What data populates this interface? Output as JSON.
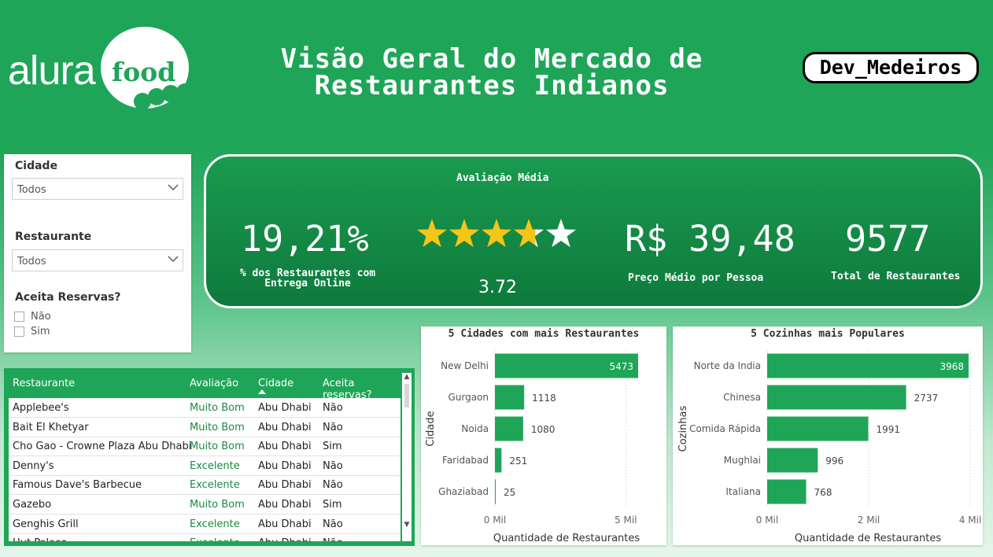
{
  "logo": {
    "word": "alura",
    "badge": "food"
  },
  "header": {
    "title_line1": "Visão Geral do Mercado de",
    "title_line2": "Restaurantes Indianos",
    "author": "Dev_Medeiros"
  },
  "filters": {
    "cidade_label": "Cidade",
    "cidade_value": "Todos",
    "restaurante_label": "Restaurante",
    "restaurante_value": "Todos",
    "reservas_label": "Aceita Reservas?",
    "options": [
      "Não",
      "Sim"
    ]
  },
  "kpis": {
    "avaliacao_label": "Avaliação Média",
    "online_value": "19,21%",
    "online_label_line1": "% dos Restaurantes com",
    "online_label_line2": "Entrega Online",
    "rating_value": "3.72",
    "rating_stars": 3.72,
    "rating_max": 5,
    "preco_value": "R$ 39,48",
    "preco_label": "Preço Médio por Pessoa",
    "total_value": "9577",
    "total_label": "Total de Restaurantes"
  },
  "table": {
    "columns": [
      "Restaurante",
      "Avaliação",
      "Cidade",
      "Aceita reservas?"
    ],
    "rows": [
      [
        "Applebee's",
        "Muito Bom",
        "Abu Dhabi",
        "Não"
      ],
      [
        "Bait El Khetyar",
        "Muito Bom",
        "Abu Dhabi",
        "Não"
      ],
      [
        "Cho Gao - Crowne Plaza Abu Dhabi",
        "Muito Bom",
        "Abu Dhabi",
        "Sim"
      ],
      [
        "Denny's",
        "Excelente",
        "Abu Dhabi",
        "Não"
      ],
      [
        "Famous Dave's Barbecue",
        "Excelente",
        "Abu Dhabi",
        "Não"
      ],
      [
        "Gazebo",
        "Muito Bom",
        "Abu Dhabi",
        "Sim"
      ],
      [
        "Genghis Grill",
        "Excelente",
        "Abu Dhabi",
        "Não"
      ],
      [
        "Hut Palace",
        "Excelente",
        "Abu Dhabi",
        "Não"
      ]
    ]
  },
  "chart_data": [
    {
      "type": "bar",
      "orientation": "horizontal",
      "title": "5 Cidades com mais Restaurantes",
      "ylabel": "Cidade",
      "xlabel": "Quantidade de Restaurantes",
      "categories": [
        "New Delhi",
        "Gurgaon",
        "Noida",
        "Faridabad",
        "Ghaziabad"
      ],
      "values": [
        5473,
        1118,
        1080,
        251,
        25
      ],
      "value_labels": [
        "5473",
        "1118",
        "1080",
        "251",
        "25"
      ],
      "xlim": [
        0,
        5473
      ],
      "ticks": [
        0,
        5000
      ],
      "tick_labels": [
        "0 Mil",
        "5 Mil"
      ],
      "color": "#1fa558"
    },
    {
      "type": "bar",
      "orientation": "horizontal",
      "title": "5 Cozinhas mais Populares",
      "ylabel": "Cozinhas",
      "xlabel": "Quantidade de Restaurantes",
      "categories": [
        "Norte da India",
        "Chinesa",
        "Comida Rápida",
        "Mughlai",
        "Italiana"
      ],
      "values": [
        3968,
        2737,
        1991,
        996,
        768
      ],
      "value_labels": [
        "3968",
        "2737",
        "1991",
        "996",
        "768"
      ],
      "xlim": [
        0,
        3968
      ],
      "ticks": [
        0,
        2000,
        4000
      ],
      "tick_labels": [
        "0 Mil",
        "2 Mil",
        "4 Mil"
      ],
      "color": "#1fa558"
    }
  ]
}
